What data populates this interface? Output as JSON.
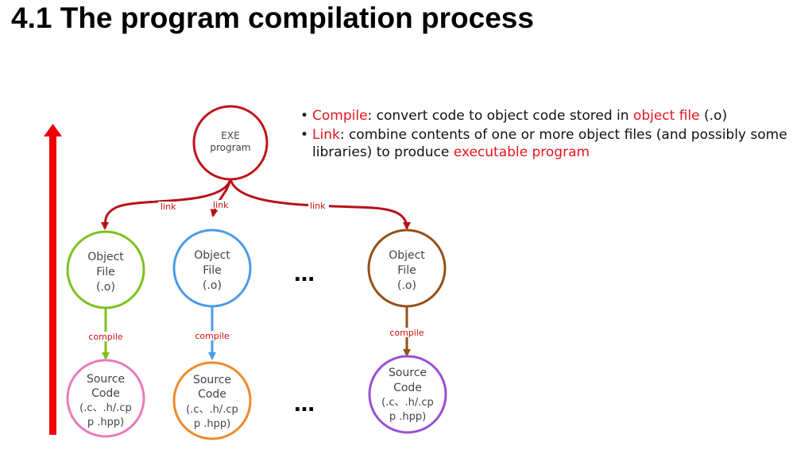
{
  "title": "4.1 The program compilation process",
  "bullets": [
    {
      "term": "Compile",
      "text_before": ": convert code to object code stored in ",
      "highlight": "object file",
      "text_after": " (.o)"
    },
    {
      "term": "Link",
      "text_before": ": combine contents of one or more object files (and possibly some libraries) to produce ",
      "highlight": "executable program",
      "text_after": ""
    }
  ],
  "nodes": {
    "exe": [
      "EXE",
      "program"
    ],
    "object_files": [
      [
        "Object",
        "File",
        "(.o)"
      ],
      [
        "Object",
        "File",
        "(.o)"
      ],
      [
        "Object",
        "File",
        "(.o)"
      ]
    ],
    "source_files": [
      [
        "Source",
        "Code",
        "(.c、.h/.cp",
        "p .hpp)"
      ],
      [
        "Source",
        "Code",
        "(.c、.h/.cp",
        "p .hpp)"
      ],
      [
        "Source",
        "Code",
        "(.c、.h/.cp",
        "p .hpp)"
      ]
    ]
  },
  "edge_labels": {
    "link": [
      "link",
      "link",
      "link"
    ],
    "compile": [
      "compile",
      "compile",
      "compile"
    ]
  },
  "ellipsis": [
    "…",
    "…"
  ],
  "colors": {
    "exe": "#c0141c",
    "object_1": "#7cc21f",
    "object_2": "#4d9be6",
    "object_3": "#955117",
    "source_1": "#e97bbd",
    "source_2": "#ee8a2c",
    "source_3": "#9b4fd6",
    "link_arrow": "#b81018",
    "vertical_arrow": "#ee0000",
    "highlight_text": "#e8141c"
  }
}
